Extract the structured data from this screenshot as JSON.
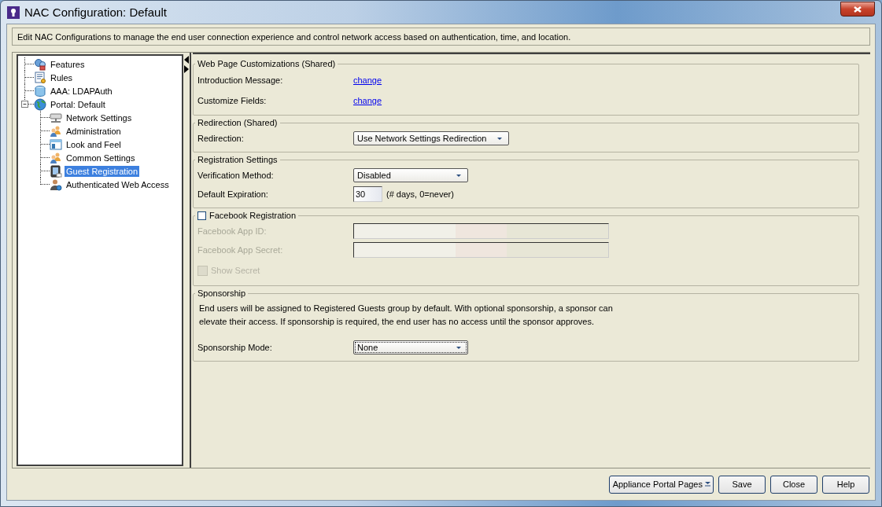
{
  "window": {
    "title": "NAC Configuration: Default"
  },
  "description": "Edit NAC Configurations to manage the end user connection experience and control network access based on authentication, time, and location.",
  "tree": [
    {
      "label": "Features",
      "selected": false
    },
    {
      "label": "Rules",
      "selected": false
    },
    {
      "label": "AAA: LDAPAuth",
      "selected": false
    },
    {
      "label": "Portal: Default",
      "selected": false,
      "expanded": true,
      "children": [
        {
          "label": "Network Settings",
          "selected": false
        },
        {
          "label": "Administration",
          "selected": false
        },
        {
          "label": "Look and Feel",
          "selected": false
        },
        {
          "label": "Common Settings",
          "selected": false
        },
        {
          "label": "Guest Registration",
          "selected": true
        },
        {
          "label": "Authenticated Web Access",
          "selected": false
        }
      ]
    }
  ],
  "sections": [
    {
      "title": "Web Page Customizations (Shared)",
      "kind": "plain",
      "rows": [
        {
          "kind": "link",
          "label": "Introduction Message:",
          "value": "change"
        },
        {
          "kind": "link",
          "label": "Customize Fields:",
          "value": "change"
        }
      ]
    },
    {
      "title": "Redirection (Shared)",
      "kind": "plain",
      "rows": [
        {
          "kind": "dropdown",
          "label": "Redirection:",
          "value": "Use Network Settings Redirection",
          "focused": false
        }
      ]
    },
    {
      "title": "Registration Settings",
      "kind": "plain",
      "rows": [
        {
          "kind": "dropdown",
          "label": "Verification Method:",
          "value": "Disabled",
          "focused": false
        },
        {
          "kind": "number",
          "label": "Default Expiration:",
          "value": "30",
          "hint": "(# days, 0=never)"
        }
      ]
    },
    {
      "title": "Facebook Registration",
      "kind": "checkbox",
      "checked": false,
      "rows": [
        {
          "kind": "text",
          "label": "Facebook App ID:",
          "disabled": true
        },
        {
          "kind": "text",
          "label": "Facebook App Secret:",
          "disabled": true
        },
        {
          "kind": "checkbox",
          "label": "Show Secret",
          "checked": false,
          "disabled": true
        }
      ]
    },
    {
      "title": "Sponsorship",
      "kind": "plain",
      "rows": [
        {
          "kind": "paragraph",
          "text": "End users will be assigned to Registered Guests group by default. With optional sponsorship, a sponsor can elevate their access. If sponsorship is required, the end user has no access until the sponsor approves."
        },
        {
          "kind": "dropdown",
          "label": "Sponsorship Mode:",
          "value": "None",
          "focused": true
        }
      ]
    }
  ],
  "buttons": [
    {
      "label": "Appliance Portal Pages",
      "kind": "menu"
    },
    {
      "label": "Save",
      "kind": "plain"
    },
    {
      "label": "Close",
      "kind": "plain"
    },
    {
      "label": "Help",
      "kind": "plain"
    }
  ]
}
